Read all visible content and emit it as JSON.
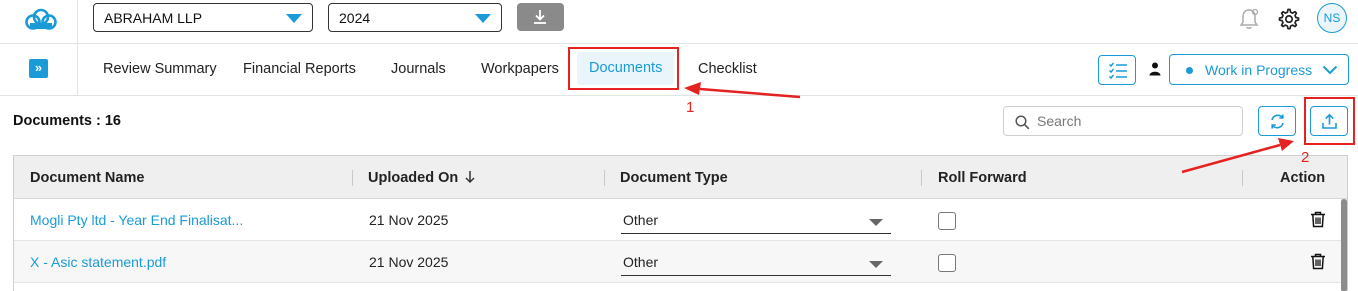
{
  "topbar": {
    "client_select": {
      "value": "ABRAHAM LLP"
    },
    "year_select": {
      "value": "2024"
    },
    "icons": {
      "logo": "cloud-logo-icon",
      "download": "download-icon",
      "notifications": "bell-icon",
      "settings": "gear-icon"
    },
    "avatar_initials": "NS"
  },
  "nav": {
    "tabs": [
      {
        "label": "Review Summary",
        "active": false
      },
      {
        "label": "Financial Reports",
        "active": false
      },
      {
        "label": "Journals",
        "active": false
      },
      {
        "label": "Workpapers",
        "active": false
      },
      {
        "label": "Documents",
        "active": true
      },
      {
        "label": "Checklist",
        "active": false
      }
    ],
    "status_select": {
      "value": "Work in Progress"
    }
  },
  "documents": {
    "count_label": "Documents : 16",
    "search_placeholder": "Search",
    "table": {
      "columns": [
        "Document Name",
        "Uploaded On",
        "Document Type",
        "Roll Forward",
        "Action"
      ],
      "sort_column": "Uploaded On",
      "sort_direction": "descending",
      "rows": [
        {
          "name": "Mogli Pty ltd - Year End Finalisat...",
          "uploaded_on": "21 Nov 2025",
          "type": "Other",
          "roll_forward": false
        },
        {
          "name": "X - Asic statement.pdf",
          "uploaded_on": "21 Nov 2025",
          "type": "Other",
          "roll_forward": false
        }
      ]
    }
  },
  "annotations": {
    "color": "#e52222",
    "labels": [
      "1",
      "2"
    ]
  },
  "colors": {
    "accent": "#1a9bd7",
    "download_button": "#8a8a8a",
    "header_bg": "#efefef"
  }
}
